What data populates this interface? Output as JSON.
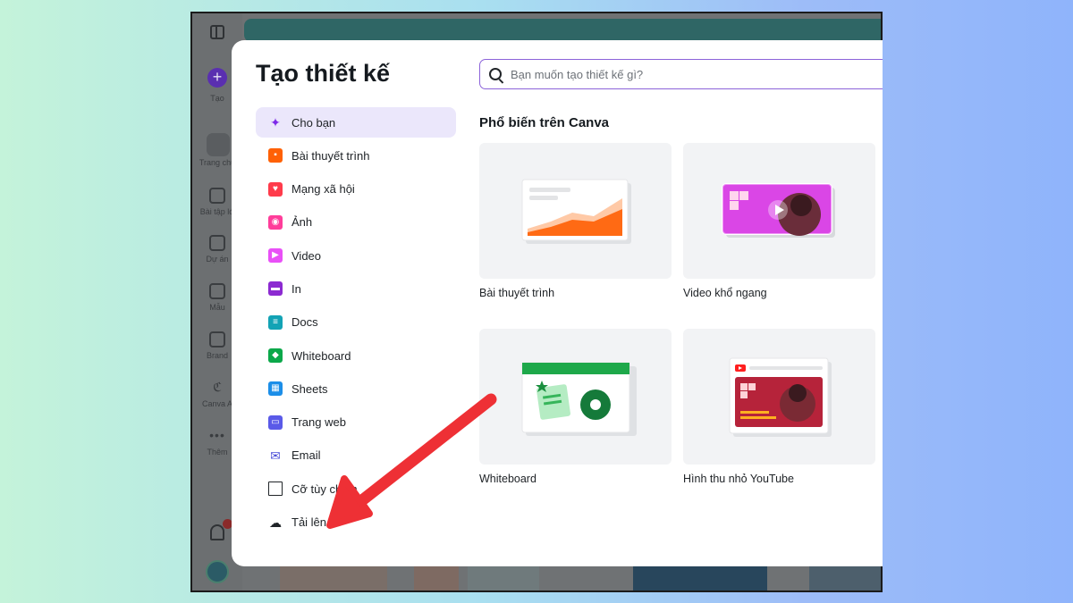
{
  "rail": {
    "items": [
      {
        "label": "Tạo"
      },
      {
        "label": "Trang chủ"
      },
      {
        "label": "Bài tập lớ"
      },
      {
        "label": "Dự án"
      },
      {
        "label": "Mẫu"
      },
      {
        "label": "Brand"
      },
      {
        "label": "Canva A"
      },
      {
        "label": "Thêm"
      }
    ],
    "notification_badge": "1"
  },
  "modal": {
    "title": "Tạo thiết kế",
    "search": {
      "placeholder": "Bạn muốn tạo thiết kế gì?",
      "value": ""
    },
    "nav": [
      {
        "label": "Cho bạn",
        "icon": "sparkle-icon",
        "color": "#7d2ae8",
        "active": true
      },
      {
        "label": "Bài thuyết trình",
        "icon": "presentation-icon",
        "color": "#ff6105"
      },
      {
        "label": "Mạng xã hội",
        "icon": "heart-icon",
        "color": "#ff3b4b"
      },
      {
        "label": "Ảnh",
        "icon": "camera-icon",
        "color": "#ff3d9a"
      },
      {
        "label": "Video",
        "icon": "video-icon",
        "color": "#e950f7"
      },
      {
        "label": "In",
        "icon": "printer-icon",
        "color": "#8c2ad1"
      },
      {
        "label": "Docs",
        "icon": "docs-icon",
        "color": "#13a3b5"
      },
      {
        "label": "Whiteboard",
        "icon": "whiteboard-icon",
        "color": "#0ba84a"
      },
      {
        "label": "Sheets",
        "icon": "sheets-icon",
        "color": "#1c8ee8"
      },
      {
        "label": "Trang web",
        "icon": "website-icon",
        "color": "#5a5ae8"
      },
      {
        "label": "Email",
        "icon": "email-icon",
        "color": "#4b4ed8"
      },
      {
        "label": "Cỡ tùy chỉnh",
        "icon": "custom-size-icon",
        "color": "#202428"
      },
      {
        "label": "Tải lên",
        "icon": "upload-cloud-icon",
        "color": "#202428"
      }
    ],
    "section_title": "Phổ biến trên Canva",
    "cards": [
      {
        "label": "Bài thuyết trình"
      },
      {
        "label": "Video khổ ngang"
      },
      {
        "label": "Whiteboard"
      },
      {
        "label": "Hình thu nhỏ YouTube"
      }
    ]
  },
  "colors": {
    "accent_purple": "#7d2ae8",
    "annotation_arrow": "#f0353a"
  }
}
